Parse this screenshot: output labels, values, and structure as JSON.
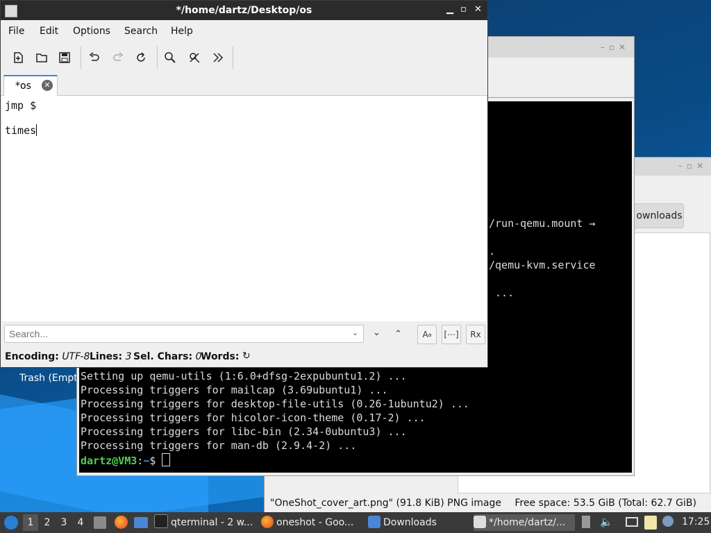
{
  "desktop": {
    "trash_label": "Trash (Empt"
  },
  "file_manager": {
    "button_label": "ownloads",
    "status_left": "\"OneShot_cover_art.png\" (91.8 KiB) PNG image",
    "status_right": "Free space: 53.5 GiB (Total: 62.7 GiB)"
  },
  "terminal": {
    "hidden_lines": [
      "/run-qemu.mount →",
      ".",
      "/qemu-kvm.service",
      " ..."
    ],
    "lines": [
      "Setting up qemu-utils (1:6.0+dfsg-2expubuntu1.2) ...",
      "Processing triggers for mailcap (3.69ubuntu1) ...",
      "Processing triggers for desktop-file-utils (0.26-1ubuntu2) ...",
      "Processing triggers for hicolor-icon-theme (0.17-2) ...",
      "Processing triggers for libc-bin (2.34-0ubuntu3) ...",
      "Processing triggers for man-db (2.9.4-2) ..."
    ],
    "prompt_user": "dartz@VM3",
    "prompt_sep": ":",
    "prompt_path": "~",
    "prompt_symbol": "$"
  },
  "editor": {
    "title": "*/home/dartz/Desktop/os",
    "menu": [
      "File",
      "Edit",
      "Options",
      "Search",
      "Help"
    ],
    "tab_label": "*os",
    "lines": [
      "jmp $",
      "",
      "times"
    ],
    "search_placeholder": "Search...",
    "status": {
      "encoding_label": "Encoding:",
      "encoding_value": "UTF-8",
      "lines_label": "Lines:",
      "lines_value": "3",
      "selchars_label": "Sel. Chars:",
      "selchars_value": "0",
      "words_label": "Words:"
    }
  },
  "taskbar": {
    "workspaces": [
      "1",
      "2",
      "3",
      "4"
    ],
    "active_workspace": "1",
    "tasks": [
      "qterminal - 2 w...",
      "oneshot - Goo...",
      "Downloads",
      "*/home/dartz/..."
    ],
    "clock": "17:25"
  },
  "colors": {
    "prompt_user": "#4fd14f",
    "prompt_path": "#5b8cff",
    "title_bar": "#2b2b2b",
    "taskbar": "#3a3a3a"
  }
}
